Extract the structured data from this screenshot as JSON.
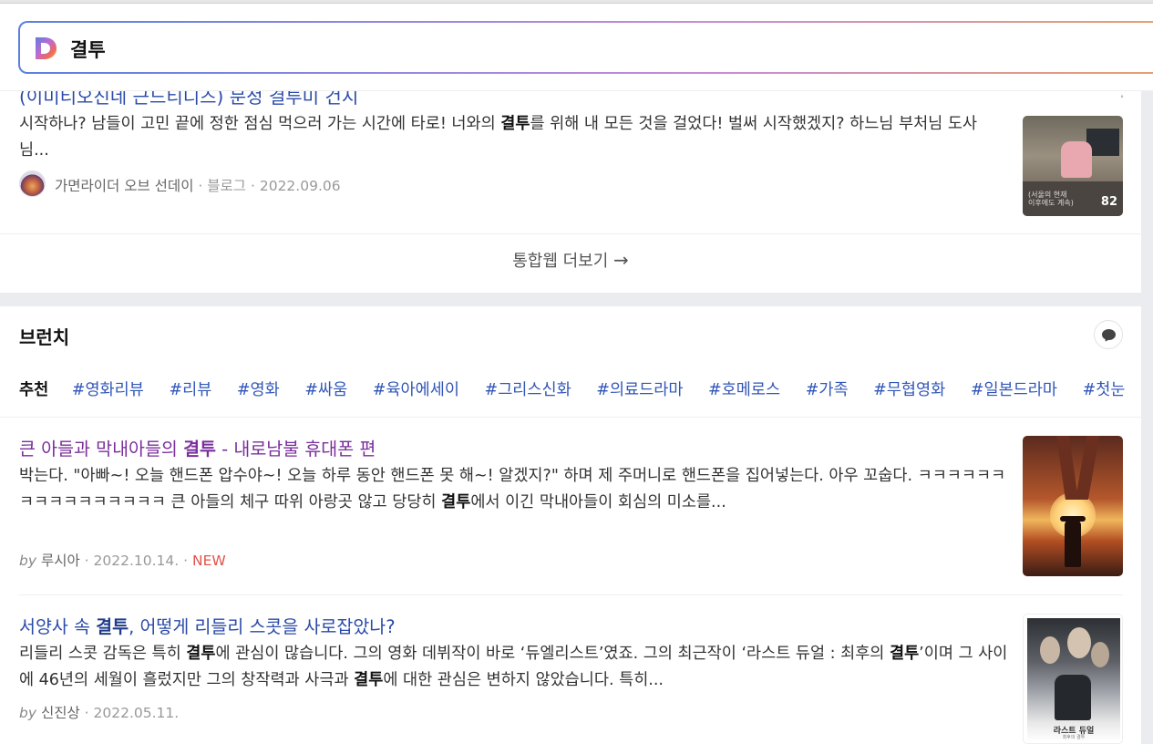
{
  "search": {
    "query": "결투",
    "logo_letter": "D"
  },
  "web_section": {
    "cut_title": "(이미티오진네 근드티디즈) 문정 결투미 건지",
    "snippet_parts": [
      "시작하나?   남들이 고민 끝에 정한 점심 먹으러 가는 시간에   타로! 너와의 ",
      "결투",
      "를 위해 내 모든 것을 걸었다!   벌써 시작했겠지?   하느님 부처님 도사님..."
    ],
    "author": "가면라이더 오브 선데이",
    "source": "블로그",
    "date": "2022.09.06",
    "thumb_count": "82",
    "thumb_caption_1": "(서울의 현재",
    "thumb_caption_2": "이후에도 계속)",
    "more_label": "통합웹 더보기",
    "more_arrow": "→"
  },
  "brunch": {
    "title": "브런치",
    "rec_label": "추천",
    "tags": [
      "#영화리뷰",
      "#리뷰",
      "#영화",
      "#싸움",
      "#육아에세이",
      "#그리스신화",
      "#의료드라마",
      "#호메로스",
      "#가족",
      "#무협영화",
      "#일본드라마",
      "#첫눈"
    ],
    "articles": [
      {
        "title_pre": "큰 아들과 막내아들의 ",
        "title_hl": "결투",
        "title_post": " - 내로남불 휴대폰 편",
        "snippet_a": "박는다. \"아빠~! 오늘 핸드폰 압수야~! 오늘 하루 동안 핸드폰 못 해~! 알겠지?\" 하며 제 주머니로 핸드폰을 집어넣는다. 아우 꼬숩다. ㅋㅋㅋㅋㅋㅋㅋㅋㅋㅋㅋㅋㅋㅋㅋㅋ 큰 아들의 체구 따위 아랑곳 않고 당당히 ",
        "snippet_hl": "결투",
        "snippet_b": "에서 이긴 막내아들이 회심의 미소를...",
        "by": "by",
        "author": "루시아",
        "date": "2022.10.14.",
        "badge": "NEW"
      },
      {
        "title_pre": "서양사 속 ",
        "title_hl": "결투",
        "title_post": ", 어떻게 리들리 스콧을 사로잡았나?",
        "snippet_a": "리들리 스콧 감독은 특히 ",
        "snippet_hl1": "결투",
        "snippet_b": "에 관심이 많습니다. 그의 영화 데뷔작이 바로 ‘듀엘리스트’였죠. 그의 최근작이 ‘라스트 듀얼 : 최후의 ",
        "snippet_hl2": "결투",
        "snippet_c": "’이며 그 사이에 46년의 세월이 흘렀지만 그의 창작력과 사극과 ",
        "snippet_hl3": "결투",
        "snippet_d": "에 대한 관심은 변하지 않았습니다. 특히...",
        "by": "by",
        "author": "신진상",
        "date": "2022.05.11.",
        "poster_title": "라스트 듀얼",
        "poster_sub": "최후의 결투"
      }
    ]
  },
  "colors": {
    "link_blue": "#2a4aa8",
    "visited_purple": "#7a2e9c",
    "tag_blue": "#3156b8",
    "new_red": "#e2534c"
  }
}
